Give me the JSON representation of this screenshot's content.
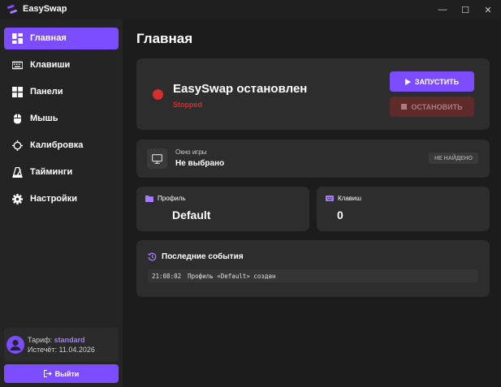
{
  "app": {
    "title": "EasySwap"
  },
  "titlebar": {
    "minimize": "—",
    "maximize": "☐",
    "close": "✕"
  },
  "sidebar": {
    "items": [
      {
        "label": "Главная",
        "icon": "dashboard-icon",
        "active": true
      },
      {
        "label": "Клавиши",
        "icon": "keyboard-icon",
        "active": false
      },
      {
        "label": "Панели",
        "icon": "grid-icon",
        "active": false
      },
      {
        "label": "Мышь",
        "icon": "mouse-icon",
        "active": false
      },
      {
        "label": "Калибровка",
        "icon": "crosshair-icon",
        "active": false
      },
      {
        "label": "Тайминги",
        "icon": "metronome-icon",
        "active": false
      },
      {
        "label": "Настройки",
        "icon": "gear-icon",
        "active": false
      }
    ],
    "plan": {
      "label": "Тариф:",
      "value": "standard",
      "expires_label": "Истечёт:",
      "expires_value": "11.04.2026"
    },
    "logout_label": "Выйти"
  },
  "main": {
    "title": "Главная",
    "status": {
      "title": "EasySwap остановлен",
      "subtitle": "Stopped",
      "color": "#d32f2f",
      "start_label": "ЗАПУСТИТЬ",
      "stop_label": "ОСТАНОВИТЬ"
    },
    "game_window": {
      "label": "Окно игры",
      "value": "Не выбрано",
      "badge": "НЕ НАЙДЕНО"
    },
    "profile": {
      "label": "Профиль",
      "value": "Default"
    },
    "keys": {
      "label": "Клавиш",
      "value": "0"
    },
    "events": {
      "title": "Последние события",
      "rows": [
        {
          "time": "21:08:02",
          "text": "Профиль «Default» создан"
        }
      ]
    }
  },
  "colors": {
    "accent": "#7c4dff",
    "background": "#1c1c1c",
    "card": "#2d2d2d",
    "sidebar": "#242424",
    "error": "#d32f2f"
  }
}
